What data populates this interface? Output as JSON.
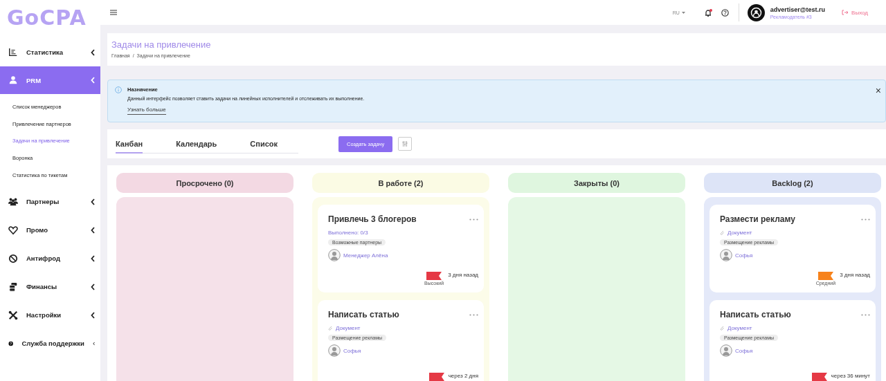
{
  "logo": "GoCPA",
  "sidebar": {
    "items": [
      {
        "label": "Статистика",
        "kind": "chart",
        "selected": false
      },
      {
        "label": "PRM",
        "kind": "user",
        "selected": true,
        "children": [
          {
            "label": "Список менеджеров",
            "selected": false
          },
          {
            "label": "Привлечение партнеров",
            "selected": false
          },
          {
            "label": "Задачи на привлечение",
            "selected": true
          },
          {
            "label": "Воронка",
            "selected": false
          },
          {
            "label": "Статистика по тикетам",
            "selected": false
          }
        ]
      },
      {
        "label": "Партнеры",
        "kind": "group",
        "selected": false
      },
      {
        "label": "Промо",
        "kind": "heart",
        "selected": false
      },
      {
        "label": "Антифрод",
        "kind": "ban",
        "selected": false
      },
      {
        "label": "Финансы",
        "kind": "coins",
        "selected": false
      },
      {
        "label": "Настройки",
        "kind": "tools",
        "selected": false
      },
      {
        "label": "Служба поддержки",
        "kind": "help",
        "selected": false
      }
    ]
  },
  "topbar": {
    "language": "RU",
    "has_notification": true,
    "user_email": "advertiser@test.ru",
    "user_role": "Рекламодатель #3",
    "logout": "Выход"
  },
  "page": {
    "title": "Задачи на привлечение",
    "breadcrumbs": [
      "Главная",
      "Задачи на привлечение"
    ],
    "breadcrumb_separator": "/"
  },
  "alert": {
    "title": "Назначение",
    "text": "Данный интерфейс позволяет ставить задачи на линейных исполнителей и отслеживать их выполнение.",
    "link": "Узнать больше",
    "close": "×"
  },
  "tabs": {
    "items": [
      {
        "label": "Канбан",
        "selected": true
      },
      {
        "label": "Календарь",
        "selected": false
      },
      {
        "label": "Список",
        "selected": false
      }
    ],
    "create_button": "Создать задачу"
  },
  "columns": [
    {
      "title": "Просрочено (0)",
      "color": "#f3d9e3"
    },
    {
      "title": "В работе (2)",
      "color": "#fbfbe4",
      "cards": [
        {
          "title": "Привлечь 3 блогеров",
          "completed": "Выполнено: 0/3",
          "tag": "Возможные партнеры",
          "assignee": "Менеджер Алёна",
          "color": "#e53945",
          "priority_label": "Высокий",
          "due": "3 дня назад"
        },
        {
          "title": "Написать статью",
          "document": "Документ",
          "tag": "Размещение рекламы",
          "assignee": "Софья",
          "color": "#e53945",
          "due": "через 2 дня"
        }
      ]
    },
    {
      "title": "Закрыты (0)",
      "color": "#dff6df"
    },
    {
      "title": "Backlog (2)",
      "color": "#dde4f7",
      "cards": [
        {
          "title": "Размести рекламу",
          "document": "Документ",
          "tag": "Размещение рекламы",
          "assignee": "Софья",
          "color": "#f7821b",
          "priority_label": "Средний",
          "due": "3 дня назад"
        },
        {
          "title": "Написать статью",
          "document": "Документ",
          "tag": "Размещение рекламы",
          "assignee": "Софья",
          "color": "#e53945",
          "due": "через 36 минут"
        }
      ]
    }
  ]
}
